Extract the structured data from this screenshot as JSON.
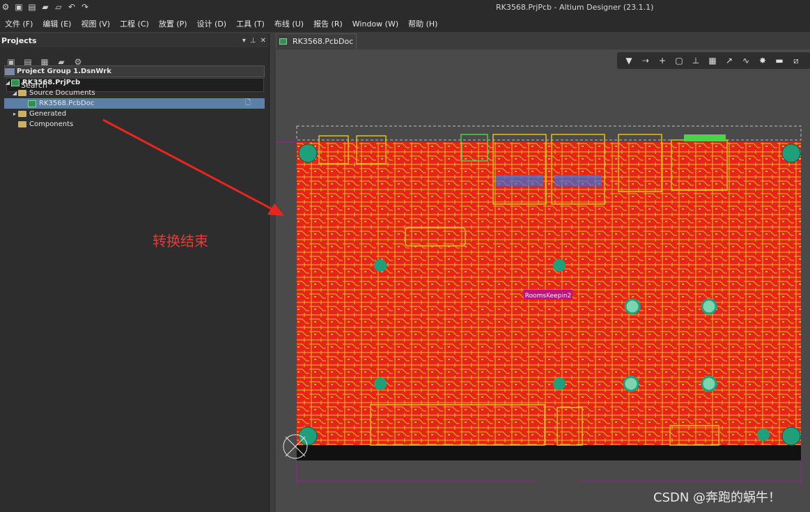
{
  "window": {
    "title": "RK3568.PrjPcb - Altium Designer (23.1.1)"
  },
  "quick_toolbar": {
    "icons": [
      "app-logo-icon",
      "save-icon",
      "save-all-icon",
      "open-icon",
      "open-project-icon",
      "undo-icon",
      "redo-icon"
    ]
  },
  "menu": {
    "items": [
      "文件 (F)",
      "编辑 (E)",
      "视图 (V)",
      "工程 (C)",
      "放置 (P)",
      "设计 (D)",
      "工具 (T)",
      "布线 (U)",
      "报告 (R)",
      "Window (W)",
      "帮助 (H)"
    ]
  },
  "projects_panel": {
    "title": "Projects",
    "controls": [
      "▾",
      "📌",
      "✕"
    ],
    "search_placeholder": "Search",
    "tree": {
      "group": "Project Group 1.DsnWrk",
      "project": "RK3568.PrjPcb",
      "source_folder": "Source Documents",
      "pcb_doc": "RK3568.PcbDoc",
      "generated": "Generated",
      "components": "Components"
    }
  },
  "document_tabs": [
    {
      "label": "RK3568.PcbDoc"
    }
  ],
  "pcb": {
    "room_label": "RoomsKeepin2",
    "board_color": "#e8231c",
    "trace_color": "#e0c21a",
    "pad_color": "#1f9f7a"
  },
  "annotation": {
    "text": "转换结束",
    "color": "#e63a3a"
  },
  "watermark": {
    "text": "CSDN @奔跑的蜗牛！"
  }
}
